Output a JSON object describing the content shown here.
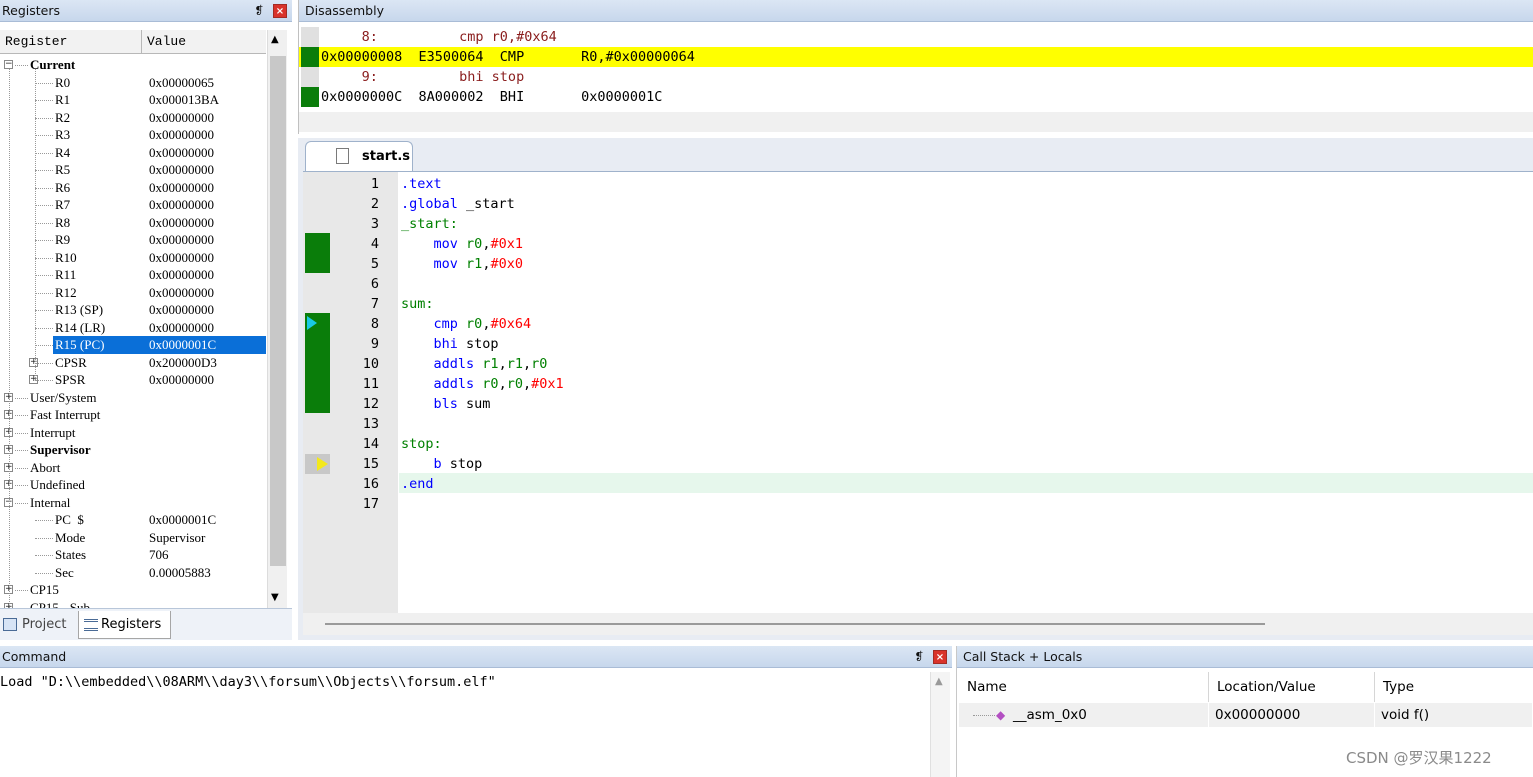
{
  "registers": {
    "title": "Registers",
    "pin_glyph": "❡",
    "close_glyph": "×",
    "columns": {
      "name": "Register",
      "value": "Value"
    },
    "groups": {
      "current": "Current"
    },
    "current": [
      {
        "name": "R0",
        "value": "0x00000065"
      },
      {
        "name": "R1",
        "value": "0x000013BA"
      },
      {
        "name": "R2",
        "value": "0x00000000"
      },
      {
        "name": "R3",
        "value": "0x00000000"
      },
      {
        "name": "R4",
        "value": "0x00000000"
      },
      {
        "name": "R5",
        "value": "0x00000000"
      },
      {
        "name": "R6",
        "value": "0x00000000"
      },
      {
        "name": "R7",
        "value": "0x00000000"
      },
      {
        "name": "R8",
        "value": "0x00000000"
      },
      {
        "name": "R9",
        "value": "0x00000000"
      },
      {
        "name": "R10",
        "value": "0x00000000"
      },
      {
        "name": "R11",
        "value": "0x00000000"
      },
      {
        "name": "R12",
        "value": "0x00000000"
      },
      {
        "name": "R13 (SP)",
        "value": "0x00000000"
      },
      {
        "name": "R14 (LR)",
        "value": "0x00000000"
      },
      {
        "name": "R15 (PC)",
        "value": "0x0000001C"
      },
      {
        "name": "CPSR",
        "value": "0x200000D3"
      },
      {
        "name": "SPSR",
        "value": "0x00000000"
      }
    ],
    "modes": [
      "User/System",
      "Fast Interrupt",
      "Interrupt",
      "Supervisor",
      "Abort",
      "Undefined"
    ],
    "internal_label": "Internal",
    "internal": [
      {
        "name": "PC  $",
        "value": "0x0000001C"
      },
      {
        "name": "Mode",
        "value": "Supervisor"
      },
      {
        "name": "States",
        "value": "706"
      },
      {
        "name": "Sec",
        "value": "0.00005883"
      }
    ],
    "cp15_label": "CP15",
    "cp15_sub_label": "CP15 - Sub"
  },
  "tabs": {
    "project": "Project",
    "registers": "Registers"
  },
  "disassembly": {
    "title": "Disassembly",
    "lines": [
      "     8:          cmp r0,#0x64",
      "0x00000008  E3500064  CMP       R0,#0x00000064",
      "     9:          bhi stop",
      "0x0000000C  8A000002  BHI       0x0000001C"
    ]
  },
  "editor": {
    "filename": "start.s",
    "lines": [
      {
        "n": "1",
        "code": ".text"
      },
      {
        "n": "2",
        "code": ".global _start"
      },
      {
        "n": "3",
        "code": "_start:"
      },
      {
        "n": "4",
        "code": "    mov r0,#0x1"
      },
      {
        "n": "5",
        "code": "    mov r1,#0x0"
      },
      {
        "n": "6",
        "code": ""
      },
      {
        "n": "7",
        "code": "sum:"
      },
      {
        "n": "8",
        "code": "    cmp r0,#0x64"
      },
      {
        "n": "9",
        "code": "    bhi stop"
      },
      {
        "n": "10",
        "code": "    addls r1,r1,r0"
      },
      {
        "n": "11",
        "code": "    addls r0,r0,#0x1"
      },
      {
        "n": "12",
        "code": "    bls sum"
      },
      {
        "n": "13",
        "code": ""
      },
      {
        "n": "14",
        "code": "stop:"
      },
      {
        "n": "15",
        "code": "    b stop"
      },
      {
        "n": "16",
        "code": ".end"
      },
      {
        "n": "17",
        "code": ""
      }
    ]
  },
  "command": {
    "title": "Command",
    "output": "Load \"D:\\\\embedded\\\\08ARM\\\\day3\\\\forsum\\\\Objects\\\\forsum.elf\""
  },
  "callstack": {
    "title": "Call Stack + Locals",
    "columns": {
      "name": "Name",
      "location": "Location/Value",
      "type": "Type"
    },
    "rows": [
      {
        "name": "__asm_0x0",
        "location": "0x00000000",
        "type": "void f()"
      }
    ]
  },
  "watermark": "CSDN @罗汉果1222",
  "colors": {
    "exec_marker": "#0a7d0a",
    "highlight": "#ffff00",
    "selection": "#0a6fd8"
  }
}
